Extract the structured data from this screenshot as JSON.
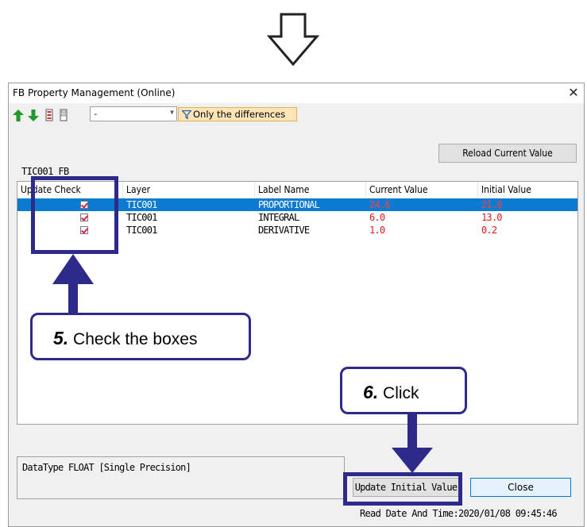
{
  "dialog": {
    "title": "FB Property Management (Online)",
    "close_glyph": "✕",
    "toolbar": {
      "combo_value": "-",
      "filter_label": "Only the differences"
    },
    "reload_label": "Reload Current Value",
    "group_label": "TIC001_FB",
    "columns": [
      "Update Check",
      "Layer",
      "Label Name",
      "Current Value",
      "Initial Value"
    ],
    "rows": [
      {
        "layer": "TIC001",
        "label": "PROPORTIONAL",
        "current": "24.6",
        "initial": "21.0",
        "checked": true,
        "selected": true
      },
      {
        "layer": "TIC001",
        "label": "INTEGRAL",
        "current": "6.0",
        "initial": "13.0",
        "checked": true,
        "selected": false
      },
      {
        "layer": "TIC001",
        "label": "DERIVATIVE",
        "current": "1.0",
        "initial": "0.2",
        "checked": true,
        "selected": false
      }
    ],
    "datatype_text": "DataType FLOAT [Single Precision]",
    "update_initial_label": "Update Initial Value",
    "close_label": "Close",
    "read_date": "Read Date And Time:2020/01/08 09:45:46"
  },
  "annotations": {
    "step5_num": "5.",
    "step5_text": "Check the boxes",
    "step6_num": "6.",
    "step6_text": "Click",
    "color": "#2d2a8a"
  },
  "icons": [
    "down-arrow-outline-icon",
    "up-arrow-icon",
    "down-arrow-icon",
    "checklist-icon",
    "list-icon",
    "filter-icon"
  ]
}
